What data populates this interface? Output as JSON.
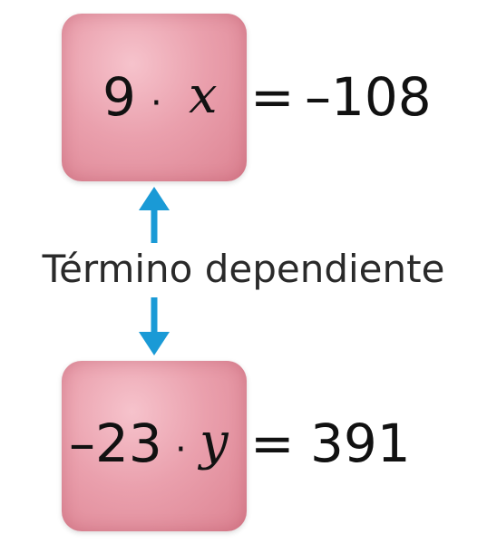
{
  "top_equation": {
    "coefficient": "9",
    "operator": "·",
    "variable": "x",
    "equals": "=",
    "result": "–108"
  },
  "bottom_equation": {
    "coefficient": "–23",
    "operator": "·",
    "variable": "y",
    "equals": "=",
    "result": "391"
  },
  "label": "Término dependiente",
  "colors": {
    "box": "#e8a0ae",
    "arrow": "#1a9ad6",
    "text": "#111111"
  }
}
